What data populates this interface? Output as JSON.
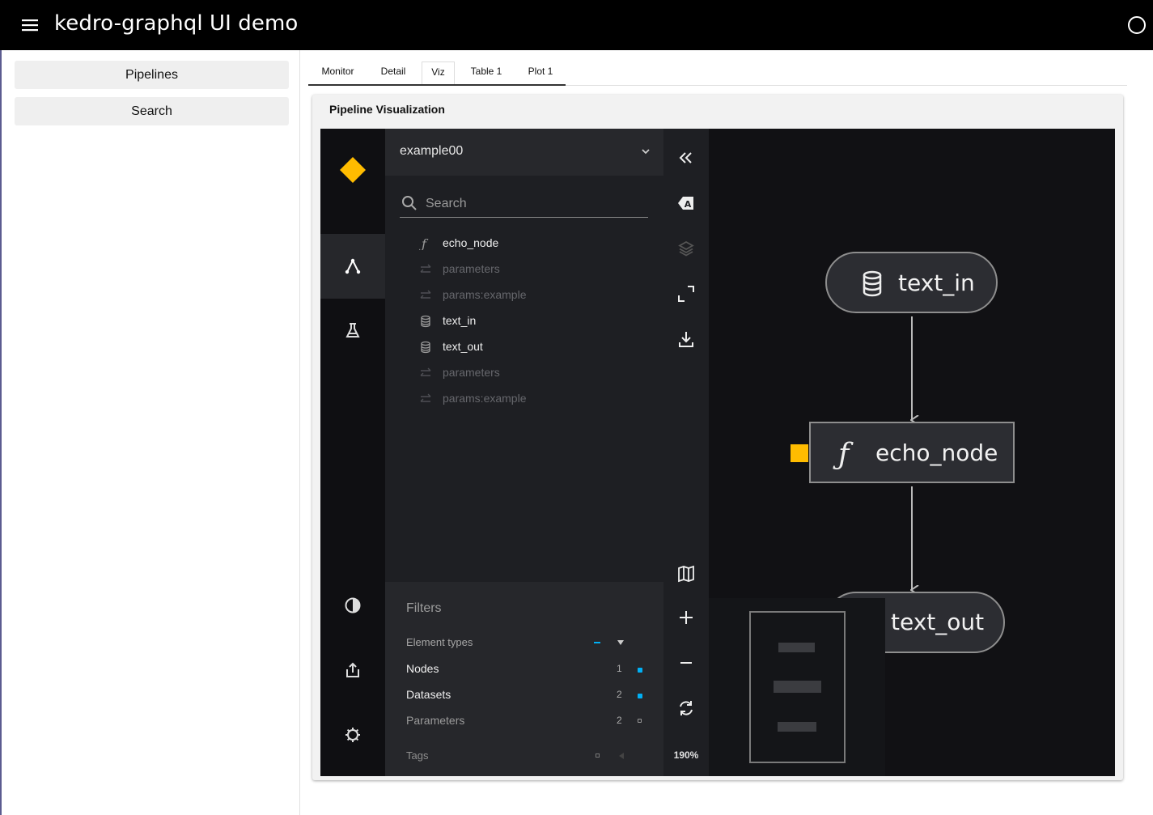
{
  "appbar": {
    "title": "kedro-graphql UI demo"
  },
  "sidebar": {
    "pipelines": "Pipelines",
    "search": "Search"
  },
  "tabs": [
    "Monitor",
    "Detail",
    "Viz",
    "Table 1",
    "Plot 1"
  ],
  "active_tab": "Viz",
  "card": {
    "title": "Pipeline Visualization"
  },
  "viz": {
    "pipeline": "example00",
    "search_placeholder": "Search",
    "nodes": [
      {
        "label": "echo_node",
        "kind": "function",
        "enabled": true
      },
      {
        "label": "parameters",
        "kind": "parameters",
        "enabled": false
      },
      {
        "label": "params:example",
        "kind": "parameters",
        "enabled": false
      },
      {
        "label": "text_in",
        "kind": "dataset",
        "enabled": true
      },
      {
        "label": "text_out",
        "kind": "dataset",
        "enabled": true
      },
      {
        "label": "parameters",
        "kind": "parameters",
        "enabled": false
      },
      {
        "label": "params:example",
        "kind": "parameters",
        "enabled": false
      }
    ],
    "filters": {
      "title": "Filters",
      "element_types": "Element types",
      "rows": [
        {
          "label": "Nodes",
          "count": "1",
          "enabled": true
        },
        {
          "label": "Datasets",
          "count": "2",
          "enabled": true
        },
        {
          "label": "Parameters",
          "count": "2",
          "enabled": false
        }
      ],
      "tags": "Tags"
    },
    "zoom": "190%",
    "graph": {
      "text_in": "text_in",
      "echo_node": "echo_node",
      "text_out": "text_out"
    },
    "colors": {
      "accent": "#ffbc00",
      "enabled_dot": "#00b0f5",
      "bg": "#111114",
      "panel": "#1e1f23"
    },
    "icons": [
      "kedro-logo-icon",
      "flowchart-icon",
      "experiment-flask-icon",
      "theme-contrast-icon",
      "export-icon",
      "settings-gear-icon",
      "collapse-double-chevron-icon",
      "label-toggle-icon",
      "layers-icon",
      "expand-icon",
      "download-icon",
      "minimap-icon",
      "zoom-in-icon",
      "zoom-out-icon",
      "reset-view-icon"
    ]
  }
}
